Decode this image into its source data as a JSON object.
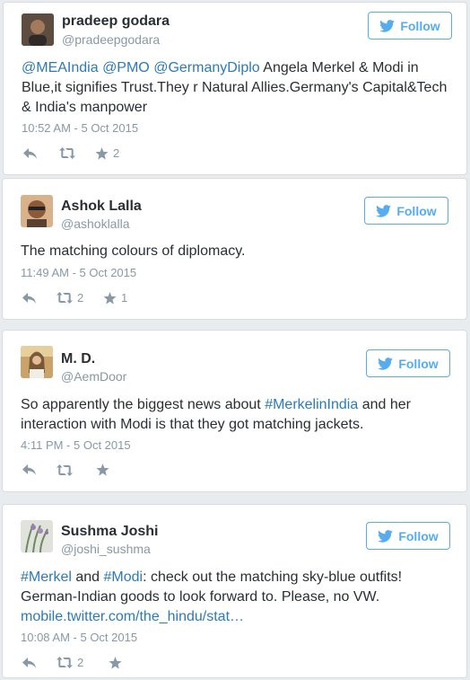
{
  "colors": {
    "link": "#2b7bb9",
    "accent": "#55acee",
    "muted": "#8899a6"
  },
  "follow_label": "Follow",
  "tweets": [
    {
      "name": "pradeep godara",
      "handle": "@pradeepgodara",
      "text_parts": [
        {
          "t": "@MEAIndia",
          "link": true
        },
        {
          "t": " ",
          "link": false
        },
        {
          "t": "@PMO",
          "link": true
        },
        {
          "t": " ",
          "link": false
        },
        {
          "t": "@GermanyDiplo",
          "link": true
        },
        {
          "t": " Angela Merkel & Modi in Blue,it signifies Trust.They r Natural Allies.Germany's Capital&Tech & India's manpower",
          "link": false
        }
      ],
      "time": "10:52 AM - 5 Oct 2015",
      "retweets": "",
      "favorites": "2"
    },
    {
      "name": "Ashok Lalla",
      "handle": "@ashoklalla",
      "text_parts": [
        {
          "t": "The matching colours of diplomacy.",
          "link": false
        }
      ],
      "time": "11:49 AM - 5 Oct 2015",
      "retweets": "2",
      "favorites": "1"
    },
    {
      "name": "M. D.",
      "handle": "@AemDoor",
      "text_parts": [
        {
          "t": "So apparently the biggest news about ",
          "link": false
        },
        {
          "t": "#MerkelinIndia",
          "link": true
        },
        {
          "t": " and her interaction with Modi is that they got matching jackets.",
          "link": false
        }
      ],
      "time": "4:11 PM - 5 Oct 2015",
      "retweets": "",
      "favorites": ""
    },
    {
      "name": "Sushma Joshi",
      "handle": "@joshi_sushma",
      "text_parts": [
        {
          "t": "#Merkel",
          "link": true
        },
        {
          "t": " and ",
          "link": false
        },
        {
          "t": "#Modi",
          "link": true
        },
        {
          "t": ": check out the matching sky-blue outfits! German-Indian goods to look forward to. Please, no VW. ",
          "link": false
        },
        {
          "t": "mobile.twitter.com/the_hindu/stat…",
          "link": true
        }
      ],
      "time": "10:08 AM - 5 Oct 2015",
      "retweets": "2",
      "favorites": ""
    }
  ]
}
